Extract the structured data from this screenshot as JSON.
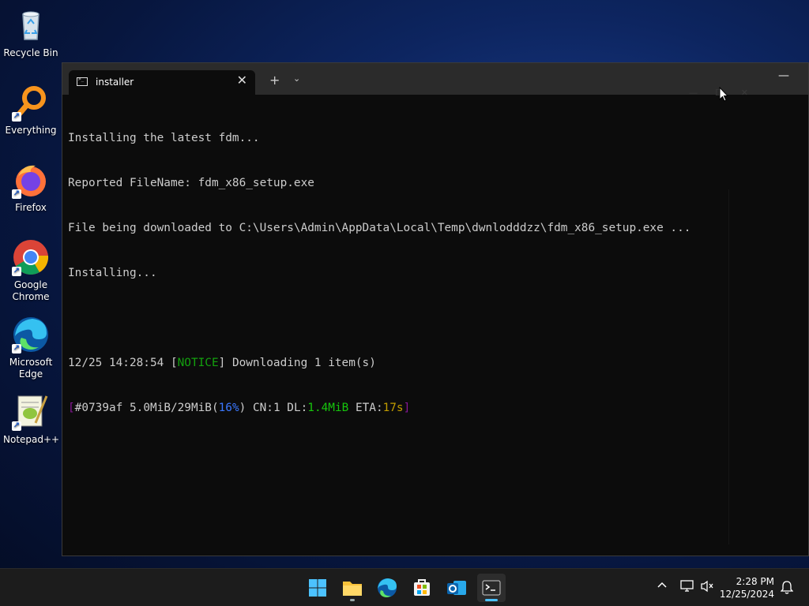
{
  "desktop": {
    "icons": [
      {
        "label": "Recycle Bin",
        "icon": "recycle-bin-icon"
      },
      {
        "label": "Everything",
        "icon": "everything-search-icon"
      },
      {
        "label": "Firefox",
        "icon": "firefox-icon"
      },
      {
        "label": "Google Chrome",
        "icon": "chrome-icon"
      },
      {
        "label": "Microsoft Edge",
        "icon": "edge-icon"
      },
      {
        "label": "Notepad++",
        "icon": "notepadpp-icon"
      }
    ]
  },
  "terminal": {
    "tab_title": "installer",
    "new_tab": "+",
    "dropdown": "⌄",
    "minimize": "—",
    "lines": [
      "Installing the latest fdm...",
      "Reported FileName: fdm_x86_setup.exe",
      "File being downloaded to C:\\Users\\Admin\\AppData\\Local\\Temp\\dwnlodddzz\\fdm_x86_setup.exe ...",
      "Installing..."
    ],
    "notice": {
      "timestamp": "12/25 14:28:54",
      "level": "NOTICE",
      "message": "Downloading 1 item(s)"
    },
    "progress": {
      "gid": "#0739af",
      "size": "5.0MiB/29MiB",
      "percent": "16%",
      "connections": "CN:1",
      "dl_label": "DL:",
      "dl_speed": "1.4MiB",
      "eta_label": "ETA:",
      "eta": "17s"
    }
  },
  "taskbar": {
    "apps": [
      "start-icon",
      "file-explorer-icon",
      "edge-icon",
      "store-icon",
      "outlook-icon",
      "terminal-icon"
    ],
    "clock": {
      "time": "2:28 PM",
      "date": "12/25/2024"
    }
  },
  "colors": {
    "notice": "#13a10e",
    "bracket": "#881798",
    "percent": "#3b78ff",
    "speed": "#16c60c",
    "eta": "#c19c00"
  }
}
